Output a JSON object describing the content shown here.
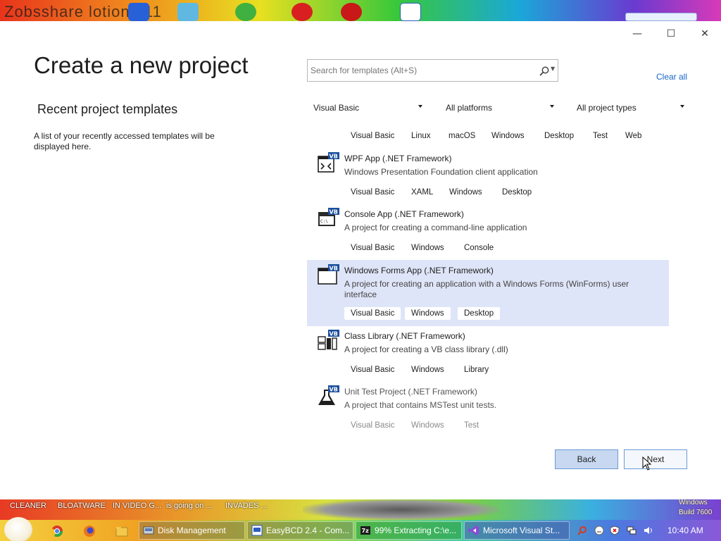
{
  "desktop": {
    "top_text": "Zobsshare lotion 011",
    "bottom_news": [
      "CLEANER",
      "BLOATWARE",
      "IN VIDEO G...",
      "is going on ...",
      "INVADES ..."
    ],
    "watermark": "Windows\nBuild 7600"
  },
  "window": {
    "controls": {
      "minimize": "—",
      "maximize": "☐",
      "close": "✕"
    },
    "title": "Create a new project",
    "recent": {
      "title": "Recent project templates",
      "description": "A list of your recently accessed templates will be displayed here."
    },
    "search": {
      "placeholder": "Search for templates (Alt+S)",
      "value": ""
    },
    "clear_all": "Clear all",
    "filters": {
      "language": "Visual Basic",
      "platform": "All platforms",
      "project_type": "All project types"
    },
    "header_tags": [
      "Visual Basic",
      "Linux",
      "macOS",
      "Windows",
      "Desktop",
      "Test",
      "Web"
    ],
    "templates": [
      {
        "name": "WPF App (.NET Framework)",
        "description": "Windows Presentation Foundation client application",
        "tags": [
          "Visual Basic",
          "XAML",
          "Windows",
          "Desktop"
        ],
        "icon": "wpf-app-icon",
        "selected": false
      },
      {
        "name": "Console App (.NET Framework)",
        "description": "A project for creating a command-line application",
        "tags": [
          "Visual Basic",
          "Windows",
          "Console"
        ],
        "icon": "console-app-icon",
        "selected": false
      },
      {
        "name": "Windows Forms App (.NET Framework)",
        "description": "A project for creating an application with a Windows Forms (WinForms) user interface",
        "tags": [
          "Visual Basic",
          "Windows",
          "Desktop"
        ],
        "icon": "winforms-app-icon",
        "selected": true
      },
      {
        "name": "Class Library (.NET Framework)",
        "description": "A project for creating a VB class library (.dll)",
        "tags": [
          "Visual Basic",
          "Windows",
          "Library"
        ],
        "icon": "class-library-icon",
        "selected": false
      },
      {
        "name": "Unit Test Project (.NET Framework)",
        "description": "A project that contains MSTest unit tests.",
        "tags": [
          "Visual Basic",
          "Windows",
          "Test"
        ],
        "icon": "unit-test-icon",
        "selected": false
      }
    ],
    "buttons": {
      "back": "Back",
      "next": "Next"
    }
  },
  "taskbar": {
    "buttons": [
      {
        "label": "Disk Management",
        "icon": "disk-management-icon"
      },
      {
        "label": "EasyBCD 2.4 - Com...",
        "icon": "easybcd-icon"
      },
      {
        "label": "99% Extracting C:\\e...",
        "icon": "7zip-icon"
      },
      {
        "label": "Microsoft Visual St...",
        "icon": "visual-studio-icon"
      }
    ],
    "clock": "10:40 AM"
  },
  "colors": {
    "accent": "#1a66c6",
    "selected_row": "#dfe5f8",
    "back_button": "#c7d8f0"
  }
}
